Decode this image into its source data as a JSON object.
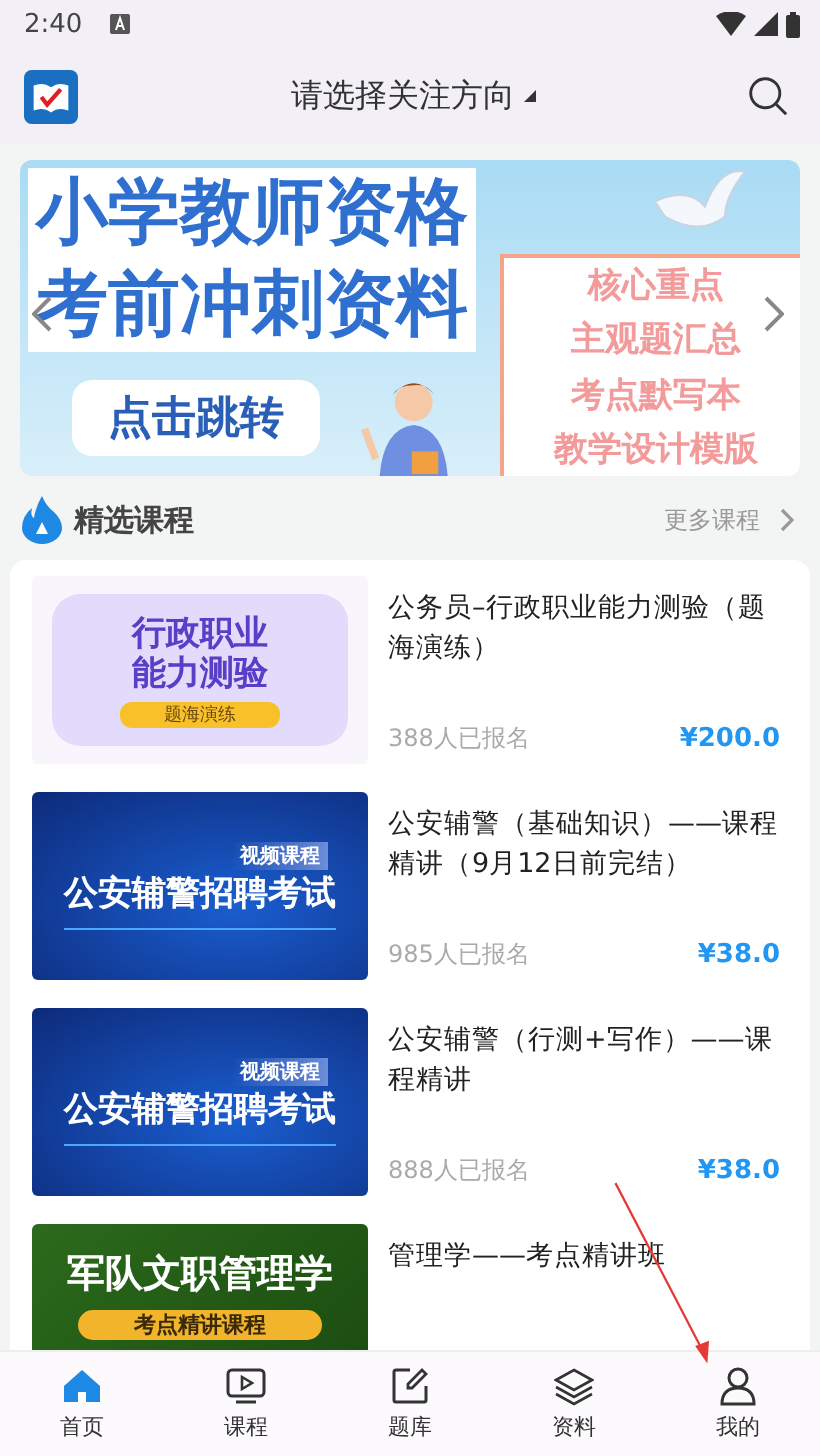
{
  "status_bar": {
    "time": "2:40"
  },
  "header": {
    "title": "请选择关注方向"
  },
  "banner": {
    "title_lines": [
      "小学教师资格",
      "考前冲刺资料"
    ],
    "button": "点击跳转",
    "list": [
      "核心重点",
      "主观题汇总",
      "考点默写本",
      "教学设计模版"
    ]
  },
  "section": {
    "title": "精选课程",
    "more": "更多课程"
  },
  "courses": [
    {
      "title": "公务员–行政职业能力测验（题海演练）",
      "enrolled": "388人已报名",
      "price": "¥200.0",
      "thumb": {
        "kind": "purple",
        "lines": [
          "行政职业",
          "能力测验"
        ],
        "tag": "题海演练"
      }
    },
    {
      "title": "公安辅警（基础知识）——课程精讲（9月12日前完结）",
      "enrolled": "985人已报名",
      "price": "¥38.0",
      "thumb": {
        "kind": "blue",
        "lines": [
          "公安辅警招聘考试"
        ],
        "tag": "视频课程"
      }
    },
    {
      "title": "公安辅警（行测+写作）——课程精讲",
      "enrolled": "888人已报名",
      "price": "¥38.0",
      "thumb": {
        "kind": "blue",
        "lines": [
          "公安辅警招聘考试"
        ],
        "tag": "视频课程"
      }
    },
    {
      "title": "管理学——考点精讲班",
      "thumb": {
        "kind": "green",
        "lines": [
          "军队文职管理学"
        ],
        "tag": "考点精讲课程"
      }
    }
  ],
  "nav": [
    {
      "label": "首页",
      "kind": "home",
      "selected": true
    },
    {
      "label": "课程",
      "kind": "video",
      "selected": false
    },
    {
      "label": "题库",
      "kind": "edit",
      "selected": false
    },
    {
      "label": "资料",
      "kind": "layers",
      "selected": false
    },
    {
      "label": "我的",
      "kind": "user",
      "selected": false
    }
  ]
}
